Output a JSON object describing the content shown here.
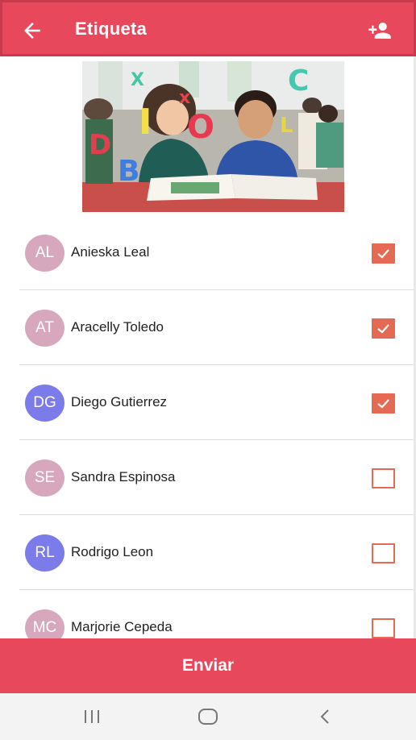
{
  "header": {
    "title": "Etiqueta",
    "back_icon": "arrow-left-icon",
    "add_user_icon": "person-add-icon",
    "color": "#e8485c"
  },
  "hero_image": {
    "letters": [
      "X",
      "I",
      "O",
      "D",
      "B",
      "C",
      "L"
    ]
  },
  "contacts": [
    {
      "initials": "AL",
      "name": "Anieska Leal",
      "checked": true,
      "avatar_color": "#d7a8bd"
    },
    {
      "initials": "AT",
      "name": "Aracelly Toledo",
      "checked": true,
      "avatar_color": "#d7a8bd"
    },
    {
      "initials": "DG",
      "name": "Diego Gutierrez",
      "checked": true,
      "avatar_color": "#7c7bea"
    },
    {
      "initials": "SE",
      "name": "Sandra Espinosa",
      "checked": false,
      "avatar_color": "#d7a8bd"
    },
    {
      "initials": "RL",
      "name": "Rodrigo Leon",
      "checked": false,
      "avatar_color": "#7c7bea"
    },
    {
      "initials": "MC",
      "name": "Marjorie Cepeda",
      "checked": false,
      "avatar_color": "#d7a8bd"
    }
  ],
  "checkbox_color": "#e46a53",
  "send_button": {
    "label": "Enviar"
  },
  "system_nav": {
    "recents_icon": "recents-icon",
    "home_icon": "home-icon",
    "back_icon": "back-chevron-icon"
  }
}
